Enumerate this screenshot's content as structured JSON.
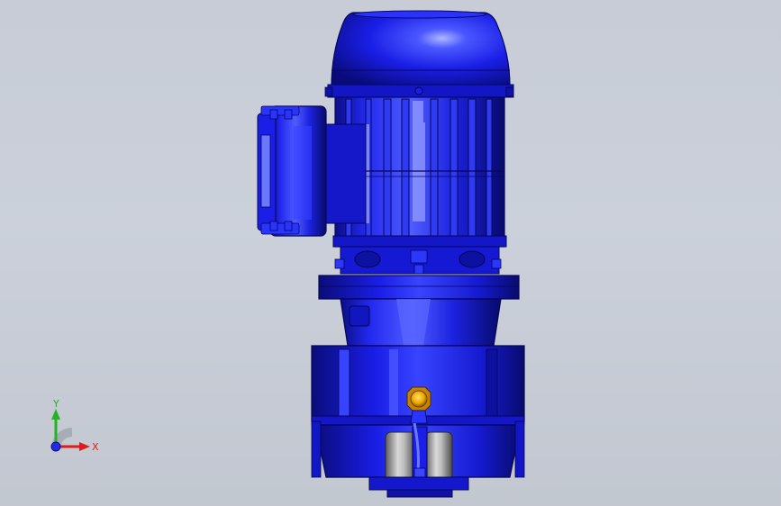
{
  "viewport": {
    "background": "#c7ccd6",
    "model_color": "#1a1ee6",
    "model_dark": "#0c0f8a",
    "model_light": "#4d5cff",
    "plug_color": "#f2a800"
  },
  "triad": {
    "x_label": "X",
    "y_label": "Y",
    "x_color": "#e01b1b",
    "y_color": "#24b324",
    "z_color": "#1f2de8"
  }
}
